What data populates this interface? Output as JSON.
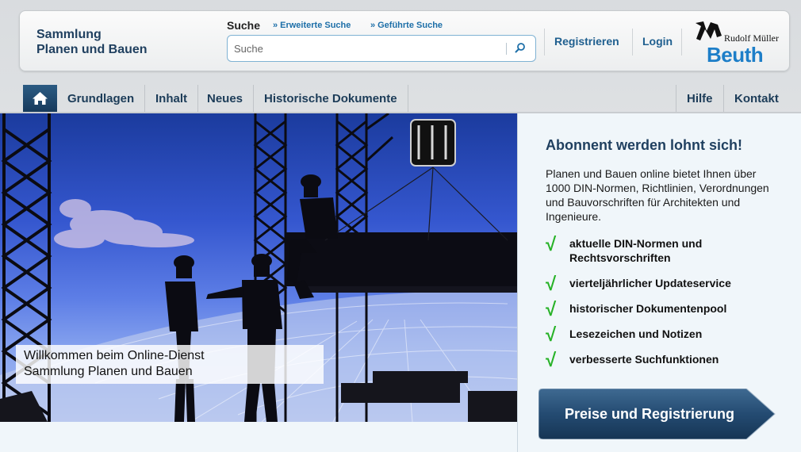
{
  "header": {
    "brand_line1": "Sammlung",
    "brand_line2": "Planen und Bauen",
    "search_label": "Suche",
    "extended_search": "Erweiterte Suche",
    "guided_search": "Geführte Suche",
    "search_placeholder": "Suche",
    "register": "Registrieren",
    "login": "Login",
    "logo_publisher": "Rudolf Müller",
    "logo_brand": "Beuth"
  },
  "nav": {
    "items": [
      "Grundlagen",
      "Inhalt",
      "Neues",
      "Historische Dokumente"
    ],
    "right_items": [
      "Hilfe",
      "Kontakt"
    ]
  },
  "hero": {
    "caption_line1": "Willkommen beim Online-Dienst",
    "caption_line2": "Sammlung Planen und Bauen"
  },
  "panel": {
    "title": "Abonnent werden lohnt sich!",
    "intro": "Planen und Bauen online bietet Ihnen über 1000 DIN-Normen, Richtlinien, Verordnungen und Bauvorschriften für Architekten und Ingenieure.",
    "features": [
      "aktuelle DIN-Normen und Rechtsvorschriften",
      "vierteljährlicher Updateservice",
      "historischer Dokumentenpool",
      "Lesezeichen und Notizen",
      "verbesserte Suchfunktionen"
    ],
    "cta": "Preise und Registrierung"
  },
  "colors": {
    "accent": "#1f5f8f",
    "check": "#27b227",
    "logo_blue": "#1d7ec8"
  }
}
